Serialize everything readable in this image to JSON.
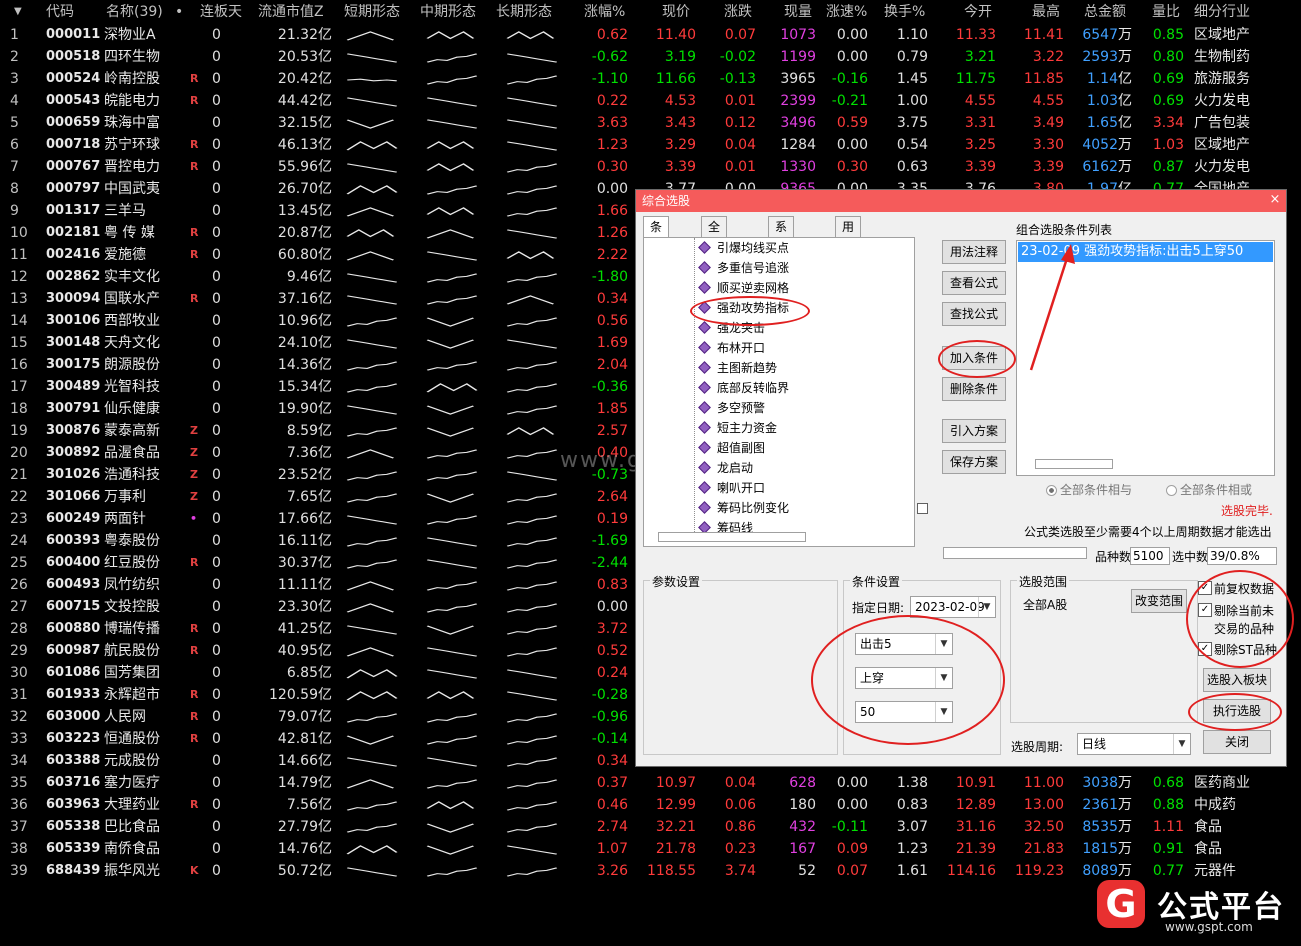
{
  "header": {
    "sort": "▼",
    "code": "代码",
    "name": "名称(39)",
    "dot": "•",
    "ltd": "连板天",
    "cap": "流通市值Z",
    "short": "短期形态",
    "mid": "中期形态",
    "long": "长期形态",
    "pct": "涨幅%",
    "price": "现价",
    "chg": "涨跌",
    "vol": "现量",
    "spd": "涨速%",
    "turn": "换手%",
    "open": "今开",
    "high": "最高",
    "amt": "总金额",
    "vr": "量比",
    "ind": "细分行业"
  },
  "rows": [
    {
      "i": "1",
      "code": "000011",
      "name": "深物业A",
      "flag": "",
      "ltd": "0",
      "cap": "21.32亿",
      "pct": "0.62",
      "price": "11.40",
      "chg": "0.07",
      "vol": "1073",
      "spd": "0.00",
      "turn": "1.10",
      "open": "11.33",
      "high": "11.41",
      "amt": "6547",
      "amtu": "万",
      "vr": "0.85",
      "ind": "区域地产",
      "s": "^",
      "m": "vv",
      "l": "vv"
    },
    {
      "i": "2",
      "code": "000518",
      "name": "四环生物",
      "flag": "",
      "ltd": "0",
      "cap": "20.53亿",
      "pct": "-0.62",
      "price": "3.19",
      "chg": "-0.02",
      "vol": "1199",
      "spd": "0.00",
      "turn": "0.79",
      "open": "3.21",
      "high": "3.22",
      "amt": "2593",
      "amtu": "万",
      "vr": "0.80",
      "ind": "生物制药",
      "s": "dn",
      "m": "up",
      "l": "dn"
    },
    {
      "i": "3",
      "code": "000524",
      "name": "岭南控股",
      "flag": "R",
      "ltd": "0",
      "cap": "20.42亿",
      "pct": "-1.10",
      "price": "11.66",
      "chg": "-0.13",
      "vol": "3965",
      "spd": "-0.16",
      "turn": "1.45",
      "open": "11.75",
      "high": "11.85",
      "amt": "1.14",
      "amtu": "亿",
      "vr": "0.69",
      "ind": "旅游服务",
      "s": "fl",
      "m": "up",
      "l": "up"
    },
    {
      "i": "4",
      "code": "000543",
      "name": "皖能电力",
      "flag": "R",
      "ltd": "0",
      "cap": "44.42亿",
      "pct": "0.22",
      "price": "4.53",
      "chg": "0.01",
      "vol": "2399",
      "spd": "-0.21",
      "turn": "1.00",
      "open": "4.55",
      "high": "4.55",
      "amt": "1.03",
      "amtu": "亿",
      "vr": "0.69",
      "ind": "火力发电",
      "s": "dn",
      "m": "dn",
      "l": "dn"
    },
    {
      "i": "5",
      "code": "000659",
      "name": "珠海中富",
      "flag": "",
      "ltd": "0",
      "cap": "32.15亿",
      "pct": "3.63",
      "price": "3.43",
      "chg": "0.12",
      "vol": "3496",
      "spd": "0.59",
      "turn": "3.75",
      "open": "3.31",
      "high": "3.49",
      "amt": "1.65",
      "amtu": "亿",
      "vr": "3.34",
      "ind": "广告包装",
      "s": "v",
      "m": "dn",
      "l": "dn"
    },
    {
      "i": "6",
      "code": "000718",
      "name": "苏宁环球",
      "flag": "R",
      "ltd": "0",
      "cap": "46.13亿",
      "pct": "1.23",
      "price": "3.29",
      "chg": "0.04",
      "vol": "1284",
      "spd": "0.00",
      "turn": "0.54",
      "open": "3.25",
      "high": "3.30",
      "amt": "4052",
      "amtu": "万",
      "vr": "1.03",
      "ind": "区域地产",
      "s": "m",
      "m": "vv",
      "l": "dn"
    },
    {
      "i": "7",
      "code": "000767",
      "name": "晋控电力",
      "flag": "R",
      "ltd": "0",
      "cap": "55.96亿",
      "pct": "0.30",
      "price": "3.39",
      "chg": "0.01",
      "vol": "1330",
      "spd": "0.30",
      "turn": "0.63",
      "open": "3.39",
      "high": "3.39",
      "amt": "6162",
      "amtu": "万",
      "vr": "0.87",
      "ind": "火力发电",
      "s": "dn",
      "m": "vv",
      "l": "up"
    },
    {
      "i": "8",
      "code": "000797",
      "name": "中国武夷",
      "flag": "",
      "ltd": "0",
      "cap": "26.70亿",
      "pct": "0.00",
      "price": "3.77",
      "chg": "0.00",
      "vol": "9365",
      "spd": "0.00",
      "turn": "3.35",
      "open": "3.76",
      "high": "3.80",
      "amt": "1.97",
      "amtu": "亿",
      "vr": "0.77",
      "ind": "全国地产",
      "s": "m",
      "m": "up",
      "l": "up"
    },
    {
      "i": "9",
      "code": "001317",
      "name": "三羊马",
      "flag": "",
      "ltd": "0",
      "cap": "13.45亿",
      "pct": "1.66",
      "price": "",
      "chg": "",
      "vol": "",
      "spd": "",
      "turn": "",
      "open": "",
      "high": "",
      "amt": "",
      "amtu": "",
      "vr": "",
      "ind": "",
      "s": "^",
      "m": "vv",
      "l": "up"
    },
    {
      "i": "10",
      "code": "002181",
      "name": "粤 传 媒",
      "flag": "R",
      "ltd": "0",
      "cap": "20.87亿",
      "pct": "1.26",
      "price": "",
      "chg": "",
      "vol": "",
      "spd": "",
      "turn": "",
      "open": "",
      "high": "",
      "amt": "",
      "amtu": "",
      "vr": "",
      "ind": "",
      "s": "vv",
      "m": "^",
      "l": "dn"
    },
    {
      "i": "11",
      "code": "002416",
      "name": "爱施德",
      "flag": "R",
      "ltd": "0",
      "cap": "60.80亿",
      "pct": "2.22",
      "price": "",
      "chg": "",
      "vol": "",
      "spd": "",
      "turn": "",
      "open": "",
      "high": "",
      "amt": "",
      "amtu": "",
      "vr": "",
      "ind": "",
      "s": "^",
      "m": "dn",
      "l": "vv"
    },
    {
      "i": "12",
      "code": "002862",
      "name": "实丰文化",
      "flag": "",
      "ltd": "0",
      "cap": "9.46亿",
      "pct": "-1.80",
      "price": "",
      "chg": "",
      "vol": "",
      "spd": "",
      "turn": "",
      "open": "",
      "high": "",
      "amt": "",
      "amtu": "",
      "vr": "",
      "ind": "",
      "s": "dn",
      "m": "up",
      "l": "up"
    },
    {
      "i": "13",
      "code": "300094",
      "name": "国联水产",
      "flag": "R",
      "ltd": "0",
      "cap": "37.16亿",
      "pct": "0.34",
      "price": "",
      "chg": "",
      "vol": "",
      "spd": "",
      "turn": "",
      "open": "",
      "high": "",
      "amt": "",
      "amtu": "",
      "vr": "",
      "ind": "",
      "s": "dn",
      "m": "up",
      "l": "^"
    },
    {
      "i": "14",
      "code": "300106",
      "name": "西部牧业",
      "flag": "",
      "ltd": "0",
      "cap": "10.96亿",
      "pct": "0.56",
      "price": "",
      "chg": "",
      "vol": "",
      "spd": "",
      "turn": "",
      "open": "",
      "high": "",
      "amt": "",
      "amtu": "",
      "vr": "",
      "ind": "",
      "s": "up",
      "m": "v",
      "l": "up"
    },
    {
      "i": "15",
      "code": "300148",
      "name": "天舟文化",
      "flag": "",
      "ltd": "0",
      "cap": "24.10亿",
      "pct": "1.69",
      "price": "",
      "chg": "",
      "vol": "",
      "spd": "",
      "turn": "",
      "open": "",
      "high": "",
      "amt": "",
      "amtu": "",
      "vr": "",
      "ind": "",
      "s": "dn",
      "m": "v",
      "l": "dn"
    },
    {
      "i": "16",
      "code": "300175",
      "name": "朗源股份",
      "flag": "",
      "ltd": "0",
      "cap": "14.36亿",
      "pct": "2.04",
      "price": "",
      "chg": "",
      "vol": "",
      "spd": "",
      "turn": "",
      "open": "",
      "high": "",
      "amt": "",
      "amtu": "",
      "vr": "",
      "ind": "",
      "s": "up",
      "m": "up",
      "l": "up"
    },
    {
      "i": "17",
      "code": "300489",
      "name": "光智科技",
      "flag": "",
      "ltd": "0",
      "cap": "15.34亿",
      "pct": "-0.36",
      "price": "",
      "chg": "",
      "vol": "",
      "spd": "",
      "turn": "",
      "open": "",
      "high": "",
      "amt": "",
      "amtu": "",
      "vr": "",
      "ind": "",
      "s": "up",
      "m": "m",
      "l": "up"
    },
    {
      "i": "18",
      "code": "300791",
      "name": "仙乐健康",
      "flag": "",
      "ltd": "0",
      "cap": "19.90亿",
      "pct": "1.85",
      "price": "",
      "chg": "",
      "vol": "",
      "spd": "",
      "turn": "",
      "open": "",
      "high": "",
      "amt": "",
      "amtu": "",
      "vr": "",
      "ind": "",
      "s": "dn",
      "m": "v",
      "l": "up"
    },
    {
      "i": "19",
      "code": "300876",
      "name": "蒙泰高新",
      "flag": "Z",
      "ltd": "0",
      "cap": "8.59亿",
      "pct": "2.57",
      "price": "",
      "chg": "",
      "vol": "",
      "spd": "",
      "turn": "",
      "open": "",
      "high": "",
      "amt": "",
      "amtu": "",
      "vr": "",
      "ind": "",
      "s": "up",
      "m": "v",
      "l": "vv"
    },
    {
      "i": "20",
      "code": "300892",
      "name": "品渥食品",
      "flag": "Z",
      "ltd": "0",
      "cap": "7.36亿",
      "pct": "0.40",
      "price": "",
      "chg": "",
      "vol": "",
      "spd": "",
      "turn": "",
      "open": "",
      "high": "",
      "amt": "",
      "amtu": "",
      "vr": "",
      "ind": "",
      "s": "^",
      "m": "up",
      "l": "up"
    },
    {
      "i": "21",
      "code": "301026",
      "name": "浩通科技",
      "flag": "Z",
      "ltd": "0",
      "cap": "23.52亿",
      "pct": "-0.73",
      "price": "",
      "chg": "",
      "vol": "",
      "spd": "",
      "turn": "",
      "open": "",
      "high": "",
      "amt": "",
      "amtu": "",
      "vr": "",
      "ind": "",
      "s": "up",
      "m": "up",
      "l": "dn"
    },
    {
      "i": "22",
      "code": "301066",
      "name": "万事利",
      "flag": "Z",
      "ltd": "0",
      "cap": "7.65亿",
      "pct": "2.64",
      "price": "",
      "chg": "",
      "vol": "",
      "spd": "",
      "turn": "",
      "open": "",
      "high": "",
      "amt": "",
      "amtu": "",
      "vr": "",
      "ind": "",
      "s": "up",
      "m": "v",
      "l": "up"
    },
    {
      "i": "23",
      "code": "600249",
      "name": "两面针",
      "flag": "•",
      "ltd": "0",
      "cap": "17.66亿",
      "pct": "0.19",
      "price": "",
      "chg": "",
      "vol": "",
      "spd": "",
      "turn": "",
      "open": "",
      "high": "",
      "amt": "",
      "amtu": "",
      "vr": "",
      "ind": "",
      "s": "dn",
      "m": "up",
      "l": "up"
    },
    {
      "i": "24",
      "code": "600393",
      "name": "粤泰股份",
      "flag": "",
      "ltd": "0",
      "cap": "16.11亿",
      "pct": "-1.69",
      "price": "",
      "chg": "",
      "vol": "",
      "spd": "",
      "turn": "",
      "open": "",
      "high": "",
      "amt": "",
      "amtu": "",
      "vr": "",
      "ind": "",
      "s": "up",
      "m": "dn",
      "l": "up"
    },
    {
      "i": "25",
      "code": "600400",
      "name": "红豆股份",
      "flag": "R",
      "ltd": "0",
      "cap": "30.37亿",
      "pct": "-2.44",
      "price": "",
      "chg": "",
      "vol": "",
      "spd": "",
      "turn": "",
      "open": "",
      "high": "",
      "amt": "",
      "amtu": "",
      "vr": "",
      "ind": "",
      "s": "up",
      "m": "dn",
      "l": "up"
    },
    {
      "i": "26",
      "code": "600493",
      "name": "凤竹纺织",
      "flag": "",
      "ltd": "0",
      "cap": "11.11亿",
      "pct": "0.83",
      "price": "",
      "chg": "",
      "vol": "",
      "spd": "",
      "turn": "",
      "open": "",
      "high": "",
      "amt": "",
      "amtu": "",
      "vr": "",
      "ind": "",
      "s": "^",
      "m": "up",
      "l": "up"
    },
    {
      "i": "27",
      "code": "600715",
      "name": "文投控股",
      "flag": "",
      "ltd": "0",
      "cap": "23.30亿",
      "pct": "0.00",
      "price": "",
      "chg": "",
      "vol": "",
      "spd": "",
      "turn": "",
      "open": "",
      "high": "",
      "amt": "",
      "amtu": "",
      "vr": "",
      "ind": "",
      "s": "^",
      "m": "up",
      "l": "up"
    },
    {
      "i": "28",
      "code": "600880",
      "name": "博瑞传播",
      "flag": "R",
      "ltd": "0",
      "cap": "41.25亿",
      "pct": "3.72",
      "price": "",
      "chg": "",
      "vol": "",
      "spd": "",
      "turn": "",
      "open": "",
      "high": "",
      "amt": "",
      "amtu": "",
      "vr": "",
      "ind": "",
      "s": "dn",
      "m": "v",
      "l": "up"
    },
    {
      "i": "29",
      "code": "600987",
      "name": "航民股份",
      "flag": "R",
      "ltd": "0",
      "cap": "40.95亿",
      "pct": "0.52",
      "price": "",
      "chg": "",
      "vol": "",
      "spd": "",
      "turn": "",
      "open": "",
      "high": "",
      "amt": "",
      "amtu": "",
      "vr": "",
      "ind": "",
      "s": "^",
      "m": "dn",
      "l": "up"
    },
    {
      "i": "30",
      "code": "601086",
      "name": "国芳集团",
      "flag": "",
      "ltd": "0",
      "cap": "6.85亿",
      "pct": "0.24",
      "price": "",
      "chg": "",
      "vol": "",
      "spd": "",
      "turn": "",
      "open": "",
      "high": "",
      "amt": "",
      "amtu": "",
      "vr": "",
      "ind": "",
      "s": "m",
      "m": "dn",
      "l": "dn"
    },
    {
      "i": "31",
      "code": "601933",
      "name": "永辉超市",
      "flag": "R",
      "ltd": "0",
      "cap": "120.59亿",
      "pct": "-0.28",
      "price": "",
      "chg": "",
      "vol": "",
      "spd": "",
      "turn": "",
      "open": "",
      "high": "",
      "amt": "",
      "amtu": "",
      "vr": "",
      "ind": "",
      "s": "m",
      "m": "vv",
      "l": "dn"
    },
    {
      "i": "32",
      "code": "603000",
      "name": "人民网",
      "flag": "R",
      "ltd": "0",
      "cap": "79.07亿",
      "pct": "-0.96",
      "price": "",
      "chg": "",
      "vol": "",
      "spd": "",
      "turn": "",
      "open": "",
      "high": "",
      "amt": "",
      "amtu": "",
      "vr": "",
      "ind": "",
      "s": "up",
      "m": "up",
      "l": "up"
    },
    {
      "i": "33",
      "code": "603223",
      "name": "恒通股份",
      "flag": "R",
      "ltd": "0",
      "cap": "42.81亿",
      "pct": "-0.14",
      "price": "",
      "chg": "",
      "vol": "",
      "spd": "",
      "turn": "",
      "open": "",
      "high": "",
      "amt": "",
      "amtu": "",
      "vr": "",
      "ind": "",
      "s": "v",
      "m": "up",
      "l": "up"
    },
    {
      "i": "34",
      "code": "603388",
      "name": "元成股份",
      "flag": "",
      "ltd": "0",
      "cap": "14.66亿",
      "pct": "0.34",
      "price": "",
      "chg": "",
      "vol": "",
      "spd": "",
      "turn": "",
      "open": "",
      "high": "",
      "amt": "",
      "amtu": "",
      "vr": "",
      "ind": "",
      "s": "dn",
      "m": "dn",
      "l": "up"
    },
    {
      "i": "35",
      "code": "603716",
      "name": "塞力医疗",
      "flag": "",
      "ltd": "0",
      "cap": "14.79亿",
      "pct": "0.37",
      "price": "10.97",
      "chg": "0.04",
      "vol": "628",
      "spd": "0.00",
      "turn": "1.38",
      "open": "10.91",
      "high": "11.00",
      "amt": "3038",
      "amtu": "万",
      "vr": "0.68",
      "ind": "医药商业",
      "s": "^",
      "m": "up",
      "l": "up"
    },
    {
      "i": "36",
      "code": "603963",
      "name": "大理药业",
      "flag": "R",
      "ltd": "0",
      "cap": "7.56亿",
      "pct": "0.46",
      "price": "12.99",
      "chg": "0.06",
      "vol": "180",
      "spd": "0.00",
      "turn": "0.83",
      "open": "12.89",
      "high": "13.00",
      "amt": "2361",
      "amtu": "万",
      "vr": "0.88",
      "ind": "中成药",
      "s": "up",
      "m": "vv",
      "l": "up"
    },
    {
      "i": "37",
      "code": "605338",
      "name": "巴比食品",
      "flag": "",
      "ltd": "0",
      "cap": "27.79亿",
      "pct": "2.74",
      "price": "32.21",
      "chg": "0.86",
      "vol": "432",
      "spd": "-0.11",
      "turn": "3.07",
      "open": "31.16",
      "high": "32.50",
      "amt": "8535",
      "amtu": "万",
      "vr": "1.11",
      "ind": "食品",
      "s": "up",
      "m": "v",
      "l": "up"
    },
    {
      "i": "38",
      "code": "605339",
      "name": "南侨食品",
      "flag": "",
      "ltd": "0",
      "cap": "14.76亿",
      "pct": "1.07",
      "price": "21.78",
      "chg": "0.23",
      "vol": "167",
      "spd": "0.09",
      "turn": "1.23",
      "open": "21.39",
      "high": "21.83",
      "amt": "1815",
      "amtu": "万",
      "vr": "0.91",
      "ind": "食品",
      "s": "m",
      "m": "v",
      "l": "dn"
    },
    {
      "i": "39",
      "code": "688439",
      "name": "振华风光",
      "flag": "K",
      "ltd": "0",
      "cap": "50.72亿",
      "pct": "3.26",
      "price": "118.55",
      "chg": "3.74",
      "vol": "52",
      "spd": "0.07",
      "turn": "1.61",
      "open": "114.16",
      "high": "119.23",
      "amt": "8089",
      "amtu": "万",
      "vr": "0.77",
      "ind": "元器件",
      "s": "dn",
      "m": "up",
      "l": "up"
    }
  ],
  "dialog": {
    "title": "综合选股",
    "close": "×",
    "tabs": [
      "条件组",
      "全部条件",
      "系统条件",
      "用户条件"
    ],
    "tree": [
      "引爆均线买点",
      "多重信号追涨",
      "顺买逆卖网格",
      "强劲攻势指标",
      "强龙突击",
      "布林开口",
      "主图新趋势",
      "底部反转临界",
      "多空预警",
      "短主力资金",
      "超值副图",
      "龙启动",
      "喇叭开口",
      "筹码比例变化",
      "筹码线"
    ],
    "buttons": {
      "help": "用法注释",
      "view": "查看公式",
      "find": "查找公式",
      "add": "加入条件",
      "del": "删除条件",
      "import": "引入方案",
      "save": "保存方案",
      "change": "改变范围",
      "toblock": "选股入板块",
      "run": "执行选股",
      "close": "关闭"
    },
    "cond_list_title": "组合选股条件列表",
    "cond_item": "23-02-09 强劲攻势指标:出击5上穿50",
    "radio_and": "全部条件相与",
    "radio_or": "全部条件相或",
    "status": "选股完毕.",
    "note": "公式类选股至少需要4个以上周期数据才能选出",
    "count_label": "品种数",
    "count_val": "5100",
    "selected_label": "选中数",
    "selected_val": "39/0.8%",
    "param_title": "参数设置",
    "cond_title": "条件设置",
    "date_label": "指定日期:",
    "date_val": "2023-02-09",
    "sel1": "出击5",
    "sel2": "上穿",
    "sel3": "50",
    "range_title": "选股范围",
    "range_val": "全部A股",
    "chk1": "前复权数据",
    "chk2a": "剔除当前未",
    "chk2b": "交易的品种",
    "chk3": "剔除ST品种",
    "period_label": "选股周期:",
    "period_val": "日线"
  },
  "watermark": "www.gspot.com",
  "brand": {
    "logo": "G",
    "name": "公式平台",
    "url": "www.gspt.com"
  }
}
